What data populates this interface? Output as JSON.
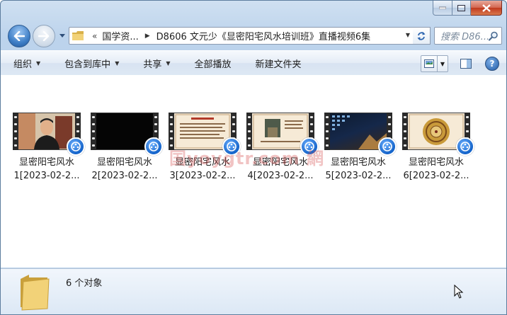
{
  "address": {
    "overflow": "«",
    "segments": [
      "国学资...",
      "D8606 文元少《显密阳宅风水培训班》直播视频6集"
    ]
  },
  "search": {
    "placeholder": "搜索 D86..."
  },
  "toolbar": {
    "organize": "组织",
    "include_library": "包含到库中",
    "share": "共享",
    "play_all": "全部播放",
    "new_folder": "新建文件夹",
    "help": "?"
  },
  "files": [
    {
      "line1": "显密阳宅风水",
      "line2": "1[2023-02-2..."
    },
    {
      "line1": "显密阳宅风水",
      "line2": "2[2023-02-2..."
    },
    {
      "line1": "显密阳宅风水",
      "line2": "3[2023-02-2..."
    },
    {
      "line1": "显密阳宅风水",
      "line2": "4[2023-02-2..."
    },
    {
      "line1": "显密阳宅风水",
      "line2": "5[2023-02-2..."
    },
    {
      "line1": "显密阳宅风水",
      "line2": "6[2023-02-2..."
    }
  ],
  "watermark": "国yoygtr.com 網",
  "status": {
    "count_text": "6 个对象"
  },
  "colors": {
    "window_frame": "#b7cfea",
    "accent_blue": "#1262c9",
    "close_red": "#c0391f"
  }
}
